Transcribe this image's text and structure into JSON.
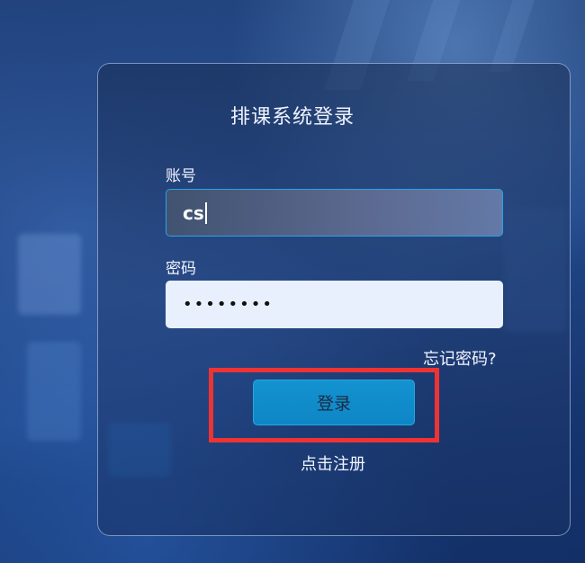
{
  "login": {
    "title": "排课系统登录",
    "account_label": "账号",
    "account_value": "cs",
    "password_label": "密码",
    "password_value": "••••••••",
    "forgot_password": "忘记密码?",
    "login_button": "登录",
    "register_link": "点击注册"
  },
  "colors": {
    "accent": "#1492cf",
    "highlight_box": "#ee3333",
    "input_border": "#2aa3e6"
  }
}
